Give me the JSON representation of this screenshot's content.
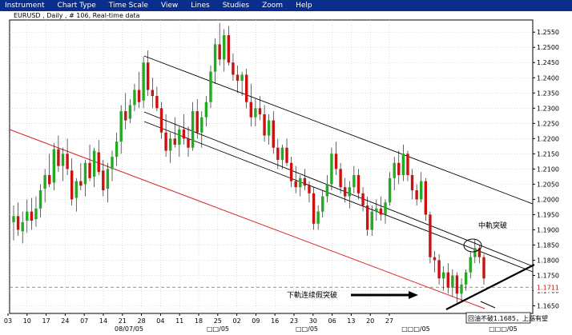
{
  "menu": {
    "items": [
      "Instrument",
      "Chart Type",
      "Time Scale",
      "View",
      "Lines",
      "Studies",
      "Zoom",
      "Help"
    ]
  },
  "chart": {
    "title": "EURUSD , Daily , # 106, Real-time data",
    "current_price_label": "1.1711",
    "annotation_upper": "中軌突破",
    "annotation_lower": "下軌连续假突破",
    "annotation_bottom": "回油不破1.1685，上漲有望"
  },
  "colors": {
    "background": "#ffffff",
    "menubar": "#0a2e8c",
    "up_candle": "#22aa22",
    "down_candle": "#cc1111",
    "channel_red": "#dd2222",
    "channel_black": "#000000",
    "grid": "#c8c8c8",
    "price_line": "#ff5555"
  },
  "chart_data": {
    "type": "candlestick",
    "title": "EURUSD , Daily , # 106, Real-time data",
    "symbol": "EURUSD",
    "timeframe": "Daily",
    "y_ticks": [
      "1.2550",
      "1.2500",
      "1.2450",
      "1.2400",
      "1.2350",
      "1.2300",
      "1.2250",
      "1.2200",
      "1.2150",
      "1.2100",
      "1.2050",
      "1.2000",
      "1.1950",
      "1.1900",
      "1.1850",
      "1.1800",
      "1.1750",
      "1.1700",
      "1.1650"
    ],
    "ylim": [
      1.1625,
      1.259
    ],
    "current_price": 1.1711,
    "x_day_ticks": [
      "03",
      "10",
      "17",
      "24",
      "07",
      "14",
      "21",
      "28",
      "04",
      "11",
      "18",
      "25",
      "02",
      "09",
      "16",
      "23",
      "30",
      "06",
      "13",
      "20",
      "27"
    ],
    "x_month_labels": [
      "08/07/05",
      "□□/05",
      "□□/05",
      "□□□/05",
      "□□□/05"
    ],
    "grid": true,
    "candles": [
      {
        "o": 1.1925,
        "h": 1.198,
        "l": 1.1865,
        "c": 1.1945
      },
      {
        "o": 1.1945,
        "h": 1.199,
        "l": 1.188,
        "c": 1.19
      },
      {
        "o": 1.1895,
        "h": 1.196,
        "l": 1.1855,
        "c": 1.1925
      },
      {
        "o": 1.193,
        "h": 1.2,
        "l": 1.189,
        "c": 1.196
      },
      {
        "o": 1.196,
        "h": 1.2005,
        "l": 1.19,
        "c": 1.193
      },
      {
        "o": 1.1935,
        "h": 1.201,
        "l": 1.191,
        "c": 1.197
      },
      {
        "o": 1.197,
        "h": 1.205,
        "l": 1.194,
        "c": 1.203
      },
      {
        "o": 1.2035,
        "h": 1.21,
        "l": 1.199,
        "c": 1.208
      },
      {
        "o": 1.208,
        "h": 1.215,
        "l": 1.204,
        "c": 1.205
      },
      {
        "o": 1.2055,
        "h": 1.2185,
        "l": 1.203,
        "c": 1.2165
      },
      {
        "o": 1.2165,
        "h": 1.221,
        "l": 1.209,
        "c": 1.211
      },
      {
        "o": 1.211,
        "h": 1.217,
        "l": 1.206,
        "c": 1.215
      },
      {
        "o": 1.215,
        "h": 1.22,
        "l": 1.208,
        "c": 1.21
      },
      {
        "o": 1.2095,
        "h": 1.2135,
        "l": 1.198,
        "c": 1.2
      },
      {
        "o": 1.2005,
        "h": 1.207,
        "l": 1.196,
        "c": 1.206
      },
      {
        "o": 1.206,
        "h": 1.212,
        "l": 1.203,
        "c": 1.2045
      },
      {
        "o": 1.205,
        "h": 1.213,
        "l": 1.201,
        "c": 1.212
      },
      {
        "o": 1.212,
        "h": 1.218,
        "l": 1.206,
        "c": 1.207
      },
      {
        "o": 1.2075,
        "h": 1.217,
        "l": 1.204,
        "c": 1.216
      },
      {
        "o": 1.2155,
        "h": 1.2195,
        "l": 1.208,
        "c": 1.209
      },
      {
        "o": 1.2095,
        "h": 1.213,
        "l": 1.201,
        "c": 1.203
      },
      {
        "o": 1.2035,
        "h": 1.212,
        "l": 1.199,
        "c": 1.21
      },
      {
        "o": 1.21,
        "h": 1.216,
        "l": 1.206,
        "c": 1.214
      },
      {
        "o": 1.214,
        "h": 1.222,
        "l": 1.211,
        "c": 1.219
      },
      {
        "o": 1.219,
        "h": 1.231,
        "l": 1.215,
        "c": 1.229
      },
      {
        "o": 1.229,
        "h": 1.235,
        "l": 1.223,
        "c": 1.226
      },
      {
        "o": 1.2265,
        "h": 1.233,
        "l": 1.225,
        "c": 1.231
      },
      {
        "o": 1.231,
        "h": 1.238,
        "l": 1.229,
        "c": 1.236
      },
      {
        "o": 1.236,
        "h": 1.242,
        "l": 1.23,
        "c": 1.232
      },
      {
        "o": 1.2325,
        "h": 1.247,
        "l": 1.23,
        "c": 1.245
      },
      {
        "o": 1.245,
        "h": 1.249,
        "l": 1.234,
        "c": 1.236
      },
      {
        "o": 1.236,
        "h": 1.24,
        "l": 1.23,
        "c": 1.234
      },
      {
        "o": 1.234,
        "h": 1.237,
        "l": 1.229,
        "c": 1.23
      },
      {
        "o": 1.23,
        "h": 1.232,
        "l": 1.22,
        "c": 1.222
      },
      {
        "o": 1.222,
        "h": 1.228,
        "l": 1.214,
        "c": 1.216
      },
      {
        "o": 1.216,
        "h": 1.222,
        "l": 1.212,
        "c": 1.22
      },
      {
        "o": 1.22,
        "h": 1.227,
        "l": 1.217,
        "c": 1.218
      },
      {
        "o": 1.218,
        "h": 1.224,
        "l": 1.214,
        "c": 1.223
      },
      {
        "o": 1.223,
        "h": 1.228,
        "l": 1.218,
        "c": 1.22
      },
      {
        "o": 1.22,
        "h": 1.224,
        "l": 1.214,
        "c": 1.217
      },
      {
        "o": 1.217,
        "h": 1.232,
        "l": 1.216,
        "c": 1.229
      },
      {
        "o": 1.229,
        "h": 1.233,
        "l": 1.22,
        "c": 1.222
      },
      {
        "o": 1.222,
        "h": 1.229,
        "l": 1.217,
        "c": 1.227
      },
      {
        "o": 1.227,
        "h": 1.234,
        "l": 1.224,
        "c": 1.232
      },
      {
        "o": 1.232,
        "h": 1.244,
        "l": 1.23,
        "c": 1.242
      },
      {
        "o": 1.242,
        "h": 1.253,
        "l": 1.238,
        "c": 1.251
      },
      {
        "o": 1.251,
        "h": 1.258,
        "l": 1.244,
        "c": 1.246
      },
      {
        "o": 1.246,
        "h": 1.256,
        "l": 1.242,
        "c": 1.254
      },
      {
        "o": 1.254,
        "h": 1.257,
        "l": 1.244,
        "c": 1.245
      },
      {
        "o": 1.245,
        "h": 1.248,
        "l": 1.239,
        "c": 1.241
      },
      {
        "o": 1.241,
        "h": 1.244,
        "l": 1.235,
        "c": 1.239
      },
      {
        "o": 1.239,
        "h": 1.242,
        "l": 1.234,
        "c": 1.241
      },
      {
        "o": 1.241,
        "h": 1.243,
        "l": 1.23,
        "c": 1.232
      },
      {
        "o": 1.232,
        "h": 1.238,
        "l": 1.224,
        "c": 1.227
      },
      {
        "o": 1.227,
        "h": 1.233,
        "l": 1.224,
        "c": 1.23
      },
      {
        "o": 1.23,
        "h": 1.234,
        "l": 1.226,
        "c": 1.228
      },
      {
        "o": 1.228,
        "h": 1.231,
        "l": 1.219,
        "c": 1.221
      },
      {
        "o": 1.221,
        "h": 1.228,
        "l": 1.218,
        "c": 1.226
      },
      {
        "o": 1.226,
        "h": 1.229,
        "l": 1.215,
        "c": 1.217
      },
      {
        "o": 1.217,
        "h": 1.22,
        "l": 1.21,
        "c": 1.213
      },
      {
        "o": 1.213,
        "h": 1.218,
        "l": 1.21,
        "c": 1.217
      },
      {
        "o": 1.217,
        "h": 1.22,
        "l": 1.211,
        "c": 1.212
      },
      {
        "o": 1.212,
        "h": 1.214,
        "l": 1.204,
        "c": 1.206
      },
      {
        "o": 1.206,
        "h": 1.211,
        "l": 1.202,
        "c": 1.204
      },
      {
        "o": 1.204,
        "h": 1.208,
        "l": 1.201,
        "c": 1.207
      },
      {
        "o": 1.207,
        "h": 1.21,
        "l": 1.203,
        "c": 1.2045
      },
      {
        "o": 1.2045,
        "h": 1.206,
        "l": 1.199,
        "c": 1.202
      },
      {
        "o": 1.202,
        "h": 1.204,
        "l": 1.19,
        "c": 1.192
      },
      {
        "o": 1.192,
        "h": 1.198,
        "l": 1.19,
        "c": 1.196
      },
      {
        "o": 1.196,
        "h": 1.203,
        "l": 1.194,
        "c": 1.201
      },
      {
        "o": 1.201,
        "h": 1.208,
        "l": 1.199,
        "c": 1.205
      },
      {
        "o": 1.205,
        "h": 1.217,
        "l": 1.203,
        "c": 1.215
      },
      {
        "o": 1.215,
        "h": 1.219,
        "l": 1.208,
        "c": 1.21
      },
      {
        "o": 1.21,
        "h": 1.212,
        "l": 1.202,
        "c": 1.204
      },
      {
        "o": 1.204,
        "h": 1.207,
        "l": 1.199,
        "c": 1.201
      },
      {
        "o": 1.201,
        "h": 1.206,
        "l": 1.197,
        "c": 1.204
      },
      {
        "o": 1.204,
        "h": 1.211,
        "l": 1.202,
        "c": 1.208
      },
      {
        "o": 1.208,
        "h": 1.21,
        "l": 1.2,
        "c": 1.202
      },
      {
        "o": 1.202,
        "h": 1.204,
        "l": 1.196,
        "c": 1.198
      },
      {
        "o": 1.198,
        "h": 1.201,
        "l": 1.188,
        "c": 1.19
      },
      {
        "o": 1.19,
        "h": 1.198,
        "l": 1.188,
        "c": 1.196
      },
      {
        "o": 1.196,
        "h": 1.2,
        "l": 1.193,
        "c": 1.197
      },
      {
        "o": 1.197,
        "h": 1.201,
        "l": 1.193,
        "c": 1.195
      },
      {
        "o": 1.195,
        "h": 1.2,
        "l": 1.192,
        "c": 1.199
      },
      {
        "o": 1.199,
        "h": 1.209,
        "l": 1.198,
        "c": 1.207
      },
      {
        "o": 1.207,
        "h": 1.214,
        "l": 1.203,
        "c": 1.212
      },
      {
        "o": 1.212,
        "h": 1.216,
        "l": 1.205,
        "c": 1.208
      },
      {
        "o": 1.208,
        "h": 1.218,
        "l": 1.206,
        "c": 1.215
      },
      {
        "o": 1.215,
        "h": 1.216,
        "l": 1.206,
        "c": 1.208
      },
      {
        "o": 1.208,
        "h": 1.21,
        "l": 1.2,
        "c": 1.203
      },
      {
        "o": 1.203,
        "h": 1.205,
        "l": 1.198,
        "c": 1.2
      },
      {
        "o": 1.2,
        "h": 1.209,
        "l": 1.199,
        "c": 1.206
      },
      {
        "o": 1.206,
        "h": 1.207,
        "l": 1.193,
        "c": 1.195
      },
      {
        "o": 1.195,
        "h": 1.196,
        "l": 1.179,
        "c": 1.181
      },
      {
        "o": 1.181,
        "h": 1.183,
        "l": 1.176,
        "c": 1.18
      },
      {
        "o": 1.18,
        "h": 1.182,
        "l": 1.172,
        "c": 1.174
      },
      {
        "o": 1.174,
        "h": 1.178,
        "l": 1.17,
        "c": 1.176
      },
      {
        "o": 1.176,
        "h": 1.179,
        "l": 1.169,
        "c": 1.171
      },
      {
        "o": 1.171,
        "h": 1.177,
        "l": 1.168,
        "c": 1.175
      },
      {
        "o": 1.175,
        "h": 1.176,
        "l": 1.166,
        "c": 1.169
      },
      {
        "o": 1.169,
        "h": 1.174,
        "l": 1.166,
        "c": 1.172
      },
      {
        "o": 1.172,
        "h": 1.177,
        "l": 1.17,
        "c": 1.176
      },
      {
        "o": 1.176,
        "h": 1.183,
        "l": 1.174,
        "c": 1.181
      },
      {
        "o": 1.181,
        "h": 1.187,
        "l": 1.179,
        "c": 1.184
      },
      {
        "o": 1.184,
        "h": 1.185,
        "l": 1.179,
        "c": 1.181
      },
      {
        "o": 1.181,
        "h": 1.182,
        "l": 1.172,
        "c": 1.174
      }
    ]
  }
}
